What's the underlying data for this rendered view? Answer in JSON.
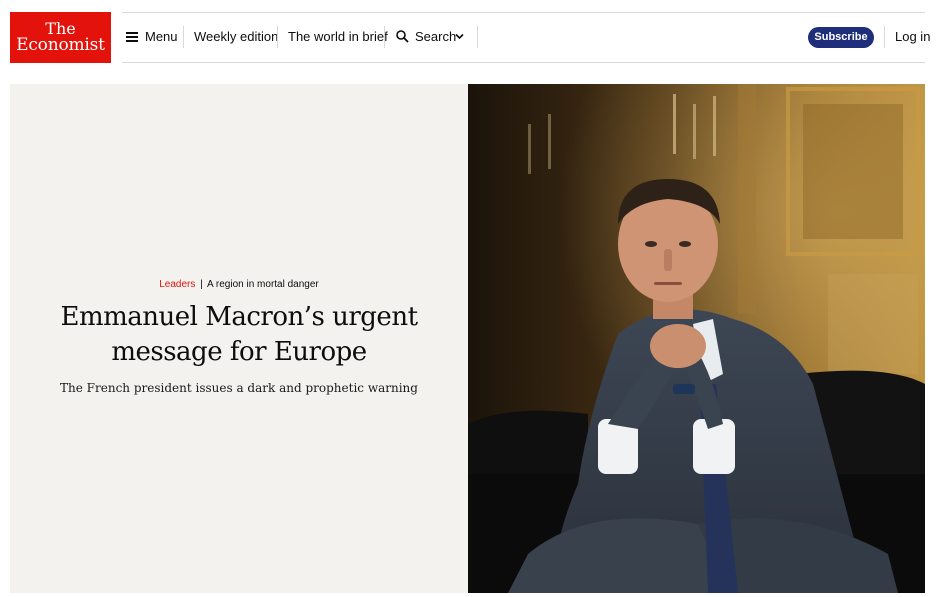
{
  "header": {
    "logo": {
      "line1": "The",
      "line2": "Economist"
    },
    "nav": {
      "menu_label": "Menu",
      "weekly_edition_label": "Weekly edition",
      "world_in_brief_label": "The world in brief",
      "search_label": "Search"
    },
    "subscribe_label": "Subscribe",
    "login_label": "Log in"
  },
  "hero": {
    "section": "Leaders",
    "separator": "|",
    "fly_title": "A region in mortal danger",
    "headline": "Emmanuel Macron’s urgent message for Europe",
    "standfirst": "The French president issues a dark and prophetic warning"
  },
  "colors": {
    "brand_red": "#e3120b",
    "subscribe_blue": "#1f2e7a",
    "hero_background": "#f3f2ee"
  },
  "icons": {
    "menu": "hamburger-icon",
    "search": "search-icon",
    "dropdown": "chevron-down-icon"
  }
}
